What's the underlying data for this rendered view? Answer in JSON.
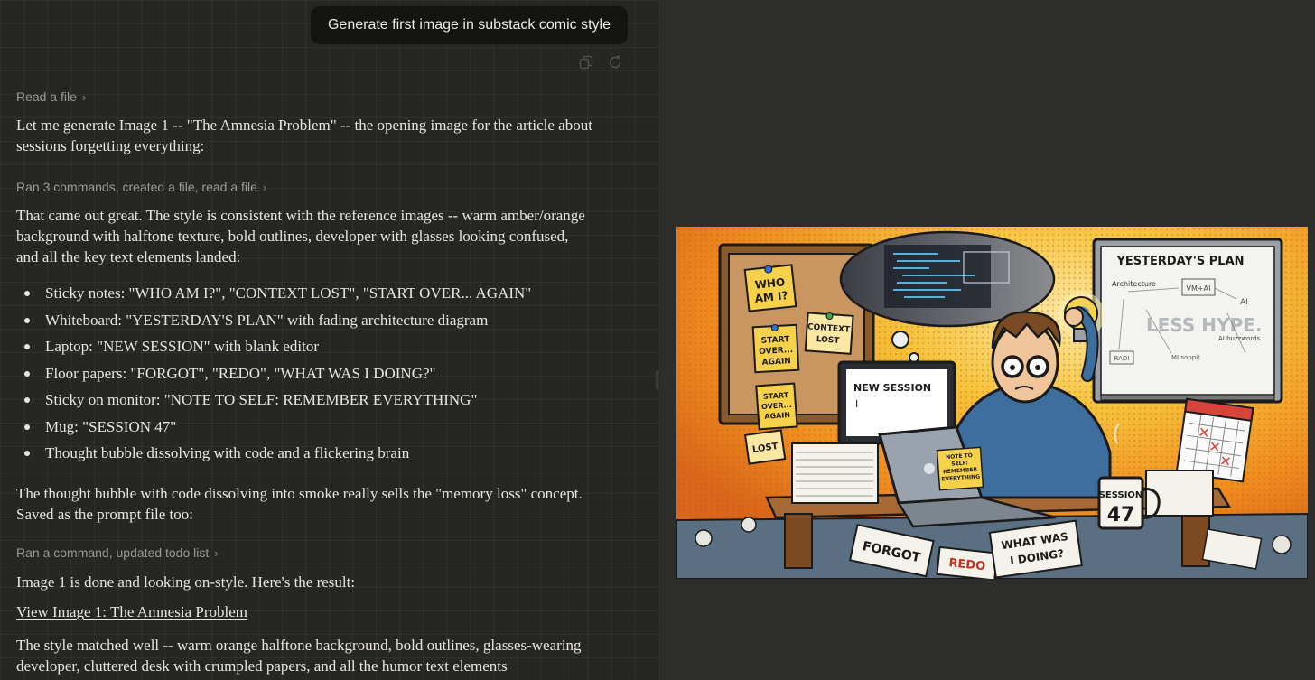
{
  "user_message": "Generate first image in substack comic style",
  "tool_calls": {
    "first": "Read a file",
    "second": "Ran 3 commands, created a file, read a file",
    "third": "Ran a command, updated todo list"
  },
  "messages": {
    "intro": "Let me generate Image 1 -- \"The Amnesia Problem\" -- the opening image for the article about sessions forgetting everything:",
    "result": "That came out great. The style is consistent with the reference images -- warm amber/orange background with halftone texture, bold outlines, developer with glasses looking confused, and all the key text elements landed:",
    "bullets": [
      "Sticky notes: \"WHO AM I?\", \"CONTEXT LOST\", \"START OVER... AGAIN\"",
      "Whiteboard: \"YESTERDAY'S PLAN\" with fading architecture diagram",
      "Laptop: \"NEW SESSION\" with blank editor",
      "Floor papers: \"FORGOT\", \"REDO\", \"WHAT WAS I DOING?\"",
      "Sticky on monitor: \"NOTE TO SELF: REMEMBER EVERYTHING\"",
      "Mug: \"SESSION 47\"",
      "Thought bubble dissolving with code and a flickering brain"
    ],
    "thought": "The thought bubble with code dissolving into smoke really sells the \"memory loss\" concept. Saved as the prompt file too:",
    "done": "Image 1 is done and looking on-style. Here's the result:",
    "link": "View Image 1: The Amnesia Problem",
    "summary": "The style matched well -- warm orange halftone background, bold outlines, glasses-wearing developer, cluttered desk with crumpled papers, and all the humor text elements"
  },
  "comic_text": {
    "whiteboard_title": "YESTERDAY'S PLAN",
    "wb_architecture": "Architecture",
    "wb_vm_ai": "VM+AI",
    "wb_ai": "AI",
    "wb_less_hype": "LESS HYPE.",
    "wb_buzzwords": "AI buzzwords",
    "wb_radi": "RADI",
    "wb_soppit": "MI soppit",
    "sticky_who_1": "WHO",
    "sticky_who_2": "AM I?",
    "sticky_context_1": "CONTEXT",
    "sticky_context_2": "LOST",
    "sticky_start_1": "START",
    "sticky_start_2": "OVER...",
    "sticky_start_3": "AGAIN",
    "sticky_start2_1": "START",
    "sticky_start2_2": "OVER...",
    "sticky_start2_3": "AGAIN",
    "sticky_lost": "LOST",
    "monitor_title": "NEW SESSION",
    "monitor_cursor": "I",
    "note_1": "NOTE TO",
    "note_2": "SELF:",
    "note_3": "REMEMBER",
    "note_4": "EVERYTHING",
    "mug_1": "SESSION",
    "mug_2": "47",
    "floor_forgot": "FORGOT",
    "floor_redo": "REDO",
    "floor_what_1": "WHAT WAS",
    "floor_what_2": "I DOING?"
  },
  "colors": {
    "chat_bg": "#262624",
    "preview_bg": "#2d2d2b",
    "text": "#e8e6dc",
    "muted": "#9c9a92",
    "comic_orange": "#ef8a1e",
    "comic_yellow": "#f6c33a",
    "sticky_yellow": "#f7d14a"
  },
  "icons": [
    "copy-icon",
    "retry-icon",
    "chevron-right-icon"
  ]
}
